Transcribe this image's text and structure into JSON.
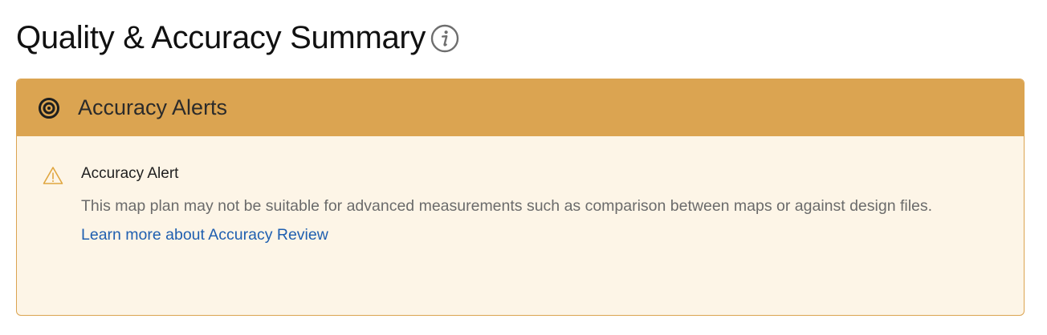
{
  "page": {
    "title": "Quality & Accuracy Summary"
  },
  "icons": {
    "info": "info-icon",
    "target": "target-icon",
    "warning": "warning-triangle-icon"
  },
  "card": {
    "header_title": "Accuracy Alerts",
    "header_color": "#dba451",
    "body_color": "#fdf5e7"
  },
  "alert": {
    "title": "Accuracy Alert",
    "description": "This map plan may not be suitable for advanced measurements such as comparison between maps or against design files.",
    "link_text": "Learn more about Accuracy Review",
    "link_color": "#1f5fb0"
  }
}
